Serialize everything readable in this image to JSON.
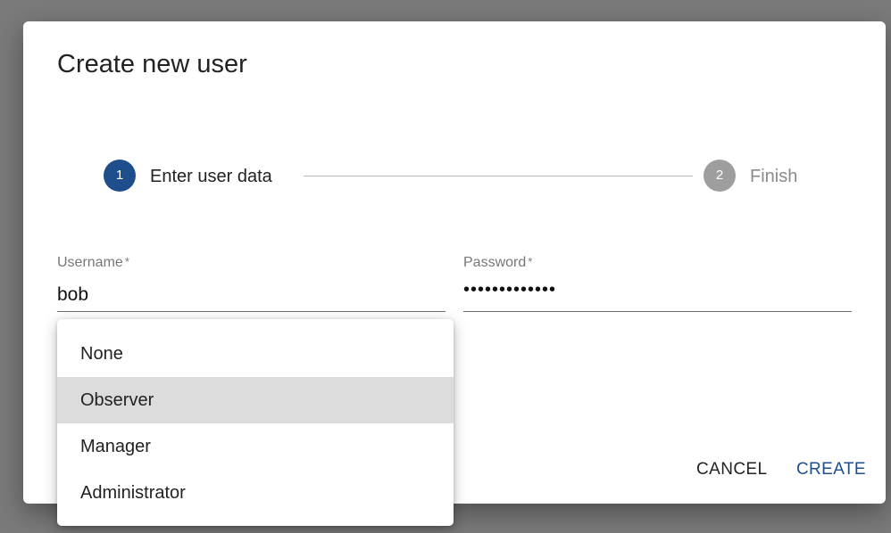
{
  "dialog": {
    "title": "Create new user"
  },
  "stepper": {
    "steps": [
      {
        "number": "1",
        "label": "Enter user data",
        "state": "active",
        "color": "#1f4e8c"
      },
      {
        "number": "2",
        "label": "Finish",
        "state": "inactive",
        "color": "#9e9e9e"
      }
    ]
  },
  "form": {
    "username": {
      "label": "Username",
      "required_mark": "*",
      "value": "bob"
    },
    "password": {
      "label": "Password",
      "required_mark": "*",
      "masked_value": "•••••••••••••"
    }
  },
  "role_menu": {
    "options": [
      "None",
      "Observer",
      "Manager",
      "Administrator"
    ],
    "highlighted": "Observer"
  },
  "actions": {
    "cancel_label": "CANCEL",
    "create_label": "CREATE",
    "accent_color": "#1f4e8c"
  }
}
